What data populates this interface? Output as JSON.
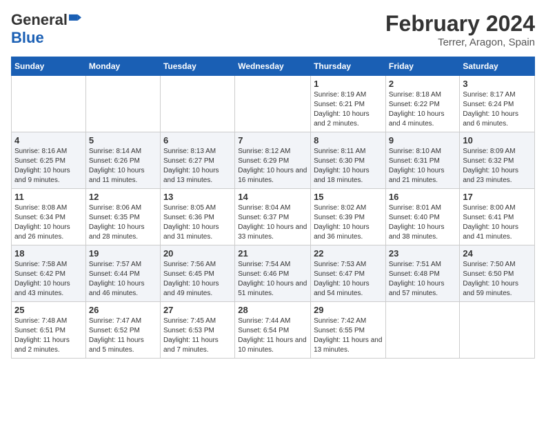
{
  "logo": {
    "general": "General",
    "blue": "Blue"
  },
  "title": "February 2024",
  "location": "Terrer, Aragon, Spain",
  "columns": [
    "Sunday",
    "Monday",
    "Tuesday",
    "Wednesday",
    "Thursday",
    "Friday",
    "Saturday"
  ],
  "weeks": [
    [
      {
        "day": "",
        "info": ""
      },
      {
        "day": "",
        "info": ""
      },
      {
        "day": "",
        "info": ""
      },
      {
        "day": "",
        "info": ""
      },
      {
        "day": "1",
        "info": "Sunrise: 8:19 AM\nSunset: 6:21 PM\nDaylight: 10 hours and 2 minutes."
      },
      {
        "day": "2",
        "info": "Sunrise: 8:18 AM\nSunset: 6:22 PM\nDaylight: 10 hours and 4 minutes."
      },
      {
        "day": "3",
        "info": "Sunrise: 8:17 AM\nSunset: 6:24 PM\nDaylight: 10 hours and 6 minutes."
      }
    ],
    [
      {
        "day": "4",
        "info": "Sunrise: 8:16 AM\nSunset: 6:25 PM\nDaylight: 10 hours and 9 minutes."
      },
      {
        "day": "5",
        "info": "Sunrise: 8:14 AM\nSunset: 6:26 PM\nDaylight: 10 hours and 11 minutes."
      },
      {
        "day": "6",
        "info": "Sunrise: 8:13 AM\nSunset: 6:27 PM\nDaylight: 10 hours and 13 minutes."
      },
      {
        "day": "7",
        "info": "Sunrise: 8:12 AM\nSunset: 6:29 PM\nDaylight: 10 hours and 16 minutes."
      },
      {
        "day": "8",
        "info": "Sunrise: 8:11 AM\nSunset: 6:30 PM\nDaylight: 10 hours and 18 minutes."
      },
      {
        "day": "9",
        "info": "Sunrise: 8:10 AM\nSunset: 6:31 PM\nDaylight: 10 hours and 21 minutes."
      },
      {
        "day": "10",
        "info": "Sunrise: 8:09 AM\nSunset: 6:32 PM\nDaylight: 10 hours and 23 minutes."
      }
    ],
    [
      {
        "day": "11",
        "info": "Sunrise: 8:08 AM\nSunset: 6:34 PM\nDaylight: 10 hours and 26 minutes."
      },
      {
        "day": "12",
        "info": "Sunrise: 8:06 AM\nSunset: 6:35 PM\nDaylight: 10 hours and 28 minutes."
      },
      {
        "day": "13",
        "info": "Sunrise: 8:05 AM\nSunset: 6:36 PM\nDaylight: 10 hours and 31 minutes."
      },
      {
        "day": "14",
        "info": "Sunrise: 8:04 AM\nSunset: 6:37 PM\nDaylight: 10 hours and 33 minutes."
      },
      {
        "day": "15",
        "info": "Sunrise: 8:02 AM\nSunset: 6:39 PM\nDaylight: 10 hours and 36 minutes."
      },
      {
        "day": "16",
        "info": "Sunrise: 8:01 AM\nSunset: 6:40 PM\nDaylight: 10 hours and 38 minutes."
      },
      {
        "day": "17",
        "info": "Sunrise: 8:00 AM\nSunset: 6:41 PM\nDaylight: 10 hours and 41 minutes."
      }
    ],
    [
      {
        "day": "18",
        "info": "Sunrise: 7:58 AM\nSunset: 6:42 PM\nDaylight: 10 hours and 43 minutes."
      },
      {
        "day": "19",
        "info": "Sunrise: 7:57 AM\nSunset: 6:44 PM\nDaylight: 10 hours and 46 minutes."
      },
      {
        "day": "20",
        "info": "Sunrise: 7:56 AM\nSunset: 6:45 PM\nDaylight: 10 hours and 49 minutes."
      },
      {
        "day": "21",
        "info": "Sunrise: 7:54 AM\nSunset: 6:46 PM\nDaylight: 10 hours and 51 minutes."
      },
      {
        "day": "22",
        "info": "Sunrise: 7:53 AM\nSunset: 6:47 PM\nDaylight: 10 hours and 54 minutes."
      },
      {
        "day": "23",
        "info": "Sunrise: 7:51 AM\nSunset: 6:48 PM\nDaylight: 10 hours and 57 minutes."
      },
      {
        "day": "24",
        "info": "Sunrise: 7:50 AM\nSunset: 6:50 PM\nDaylight: 10 hours and 59 minutes."
      }
    ],
    [
      {
        "day": "25",
        "info": "Sunrise: 7:48 AM\nSunset: 6:51 PM\nDaylight: 11 hours and 2 minutes."
      },
      {
        "day": "26",
        "info": "Sunrise: 7:47 AM\nSunset: 6:52 PM\nDaylight: 11 hours and 5 minutes."
      },
      {
        "day": "27",
        "info": "Sunrise: 7:45 AM\nSunset: 6:53 PM\nDaylight: 11 hours and 7 minutes."
      },
      {
        "day": "28",
        "info": "Sunrise: 7:44 AM\nSunset: 6:54 PM\nDaylight: 11 hours and 10 minutes."
      },
      {
        "day": "29",
        "info": "Sunrise: 7:42 AM\nSunset: 6:55 PM\nDaylight: 11 hours and 13 minutes."
      },
      {
        "day": "",
        "info": ""
      },
      {
        "day": "",
        "info": ""
      }
    ]
  ]
}
